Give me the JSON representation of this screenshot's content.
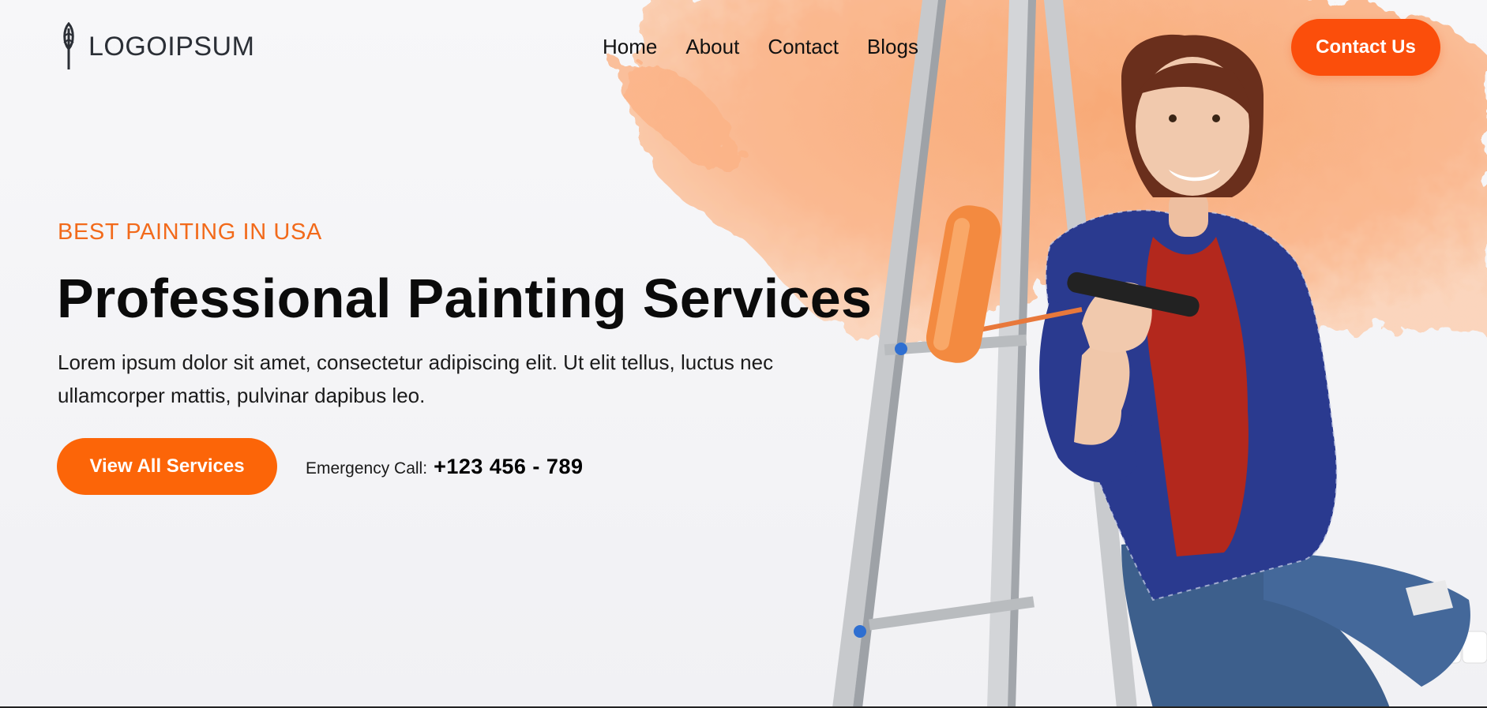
{
  "brand": {
    "logo_text": "LOGOIPSUM",
    "accent_color": "#fb4e0b",
    "secondary_accent": "#fc6508"
  },
  "nav": {
    "items": [
      {
        "label": "Home"
      },
      {
        "label": "About"
      },
      {
        "label": "Contact"
      },
      {
        "label": "Blogs"
      }
    ],
    "cta_label": "Contact Us"
  },
  "hero": {
    "eyebrow": "BEST PAINTING IN USA",
    "title": "Professional Painting Services",
    "description": "Lorem ipsum dolor sit amet, consectetur adipiscing elit. Ut elit tellus, luctus nec ullamcorper mattis, pulvinar dapibus leo.",
    "primary_button": "View All Services",
    "emergency_label": "Emergency Call:",
    "emergency_phone": "+123 456 - 789"
  },
  "image": {
    "subject": "painter-woman-with-roller-on-ladder-icon"
  }
}
